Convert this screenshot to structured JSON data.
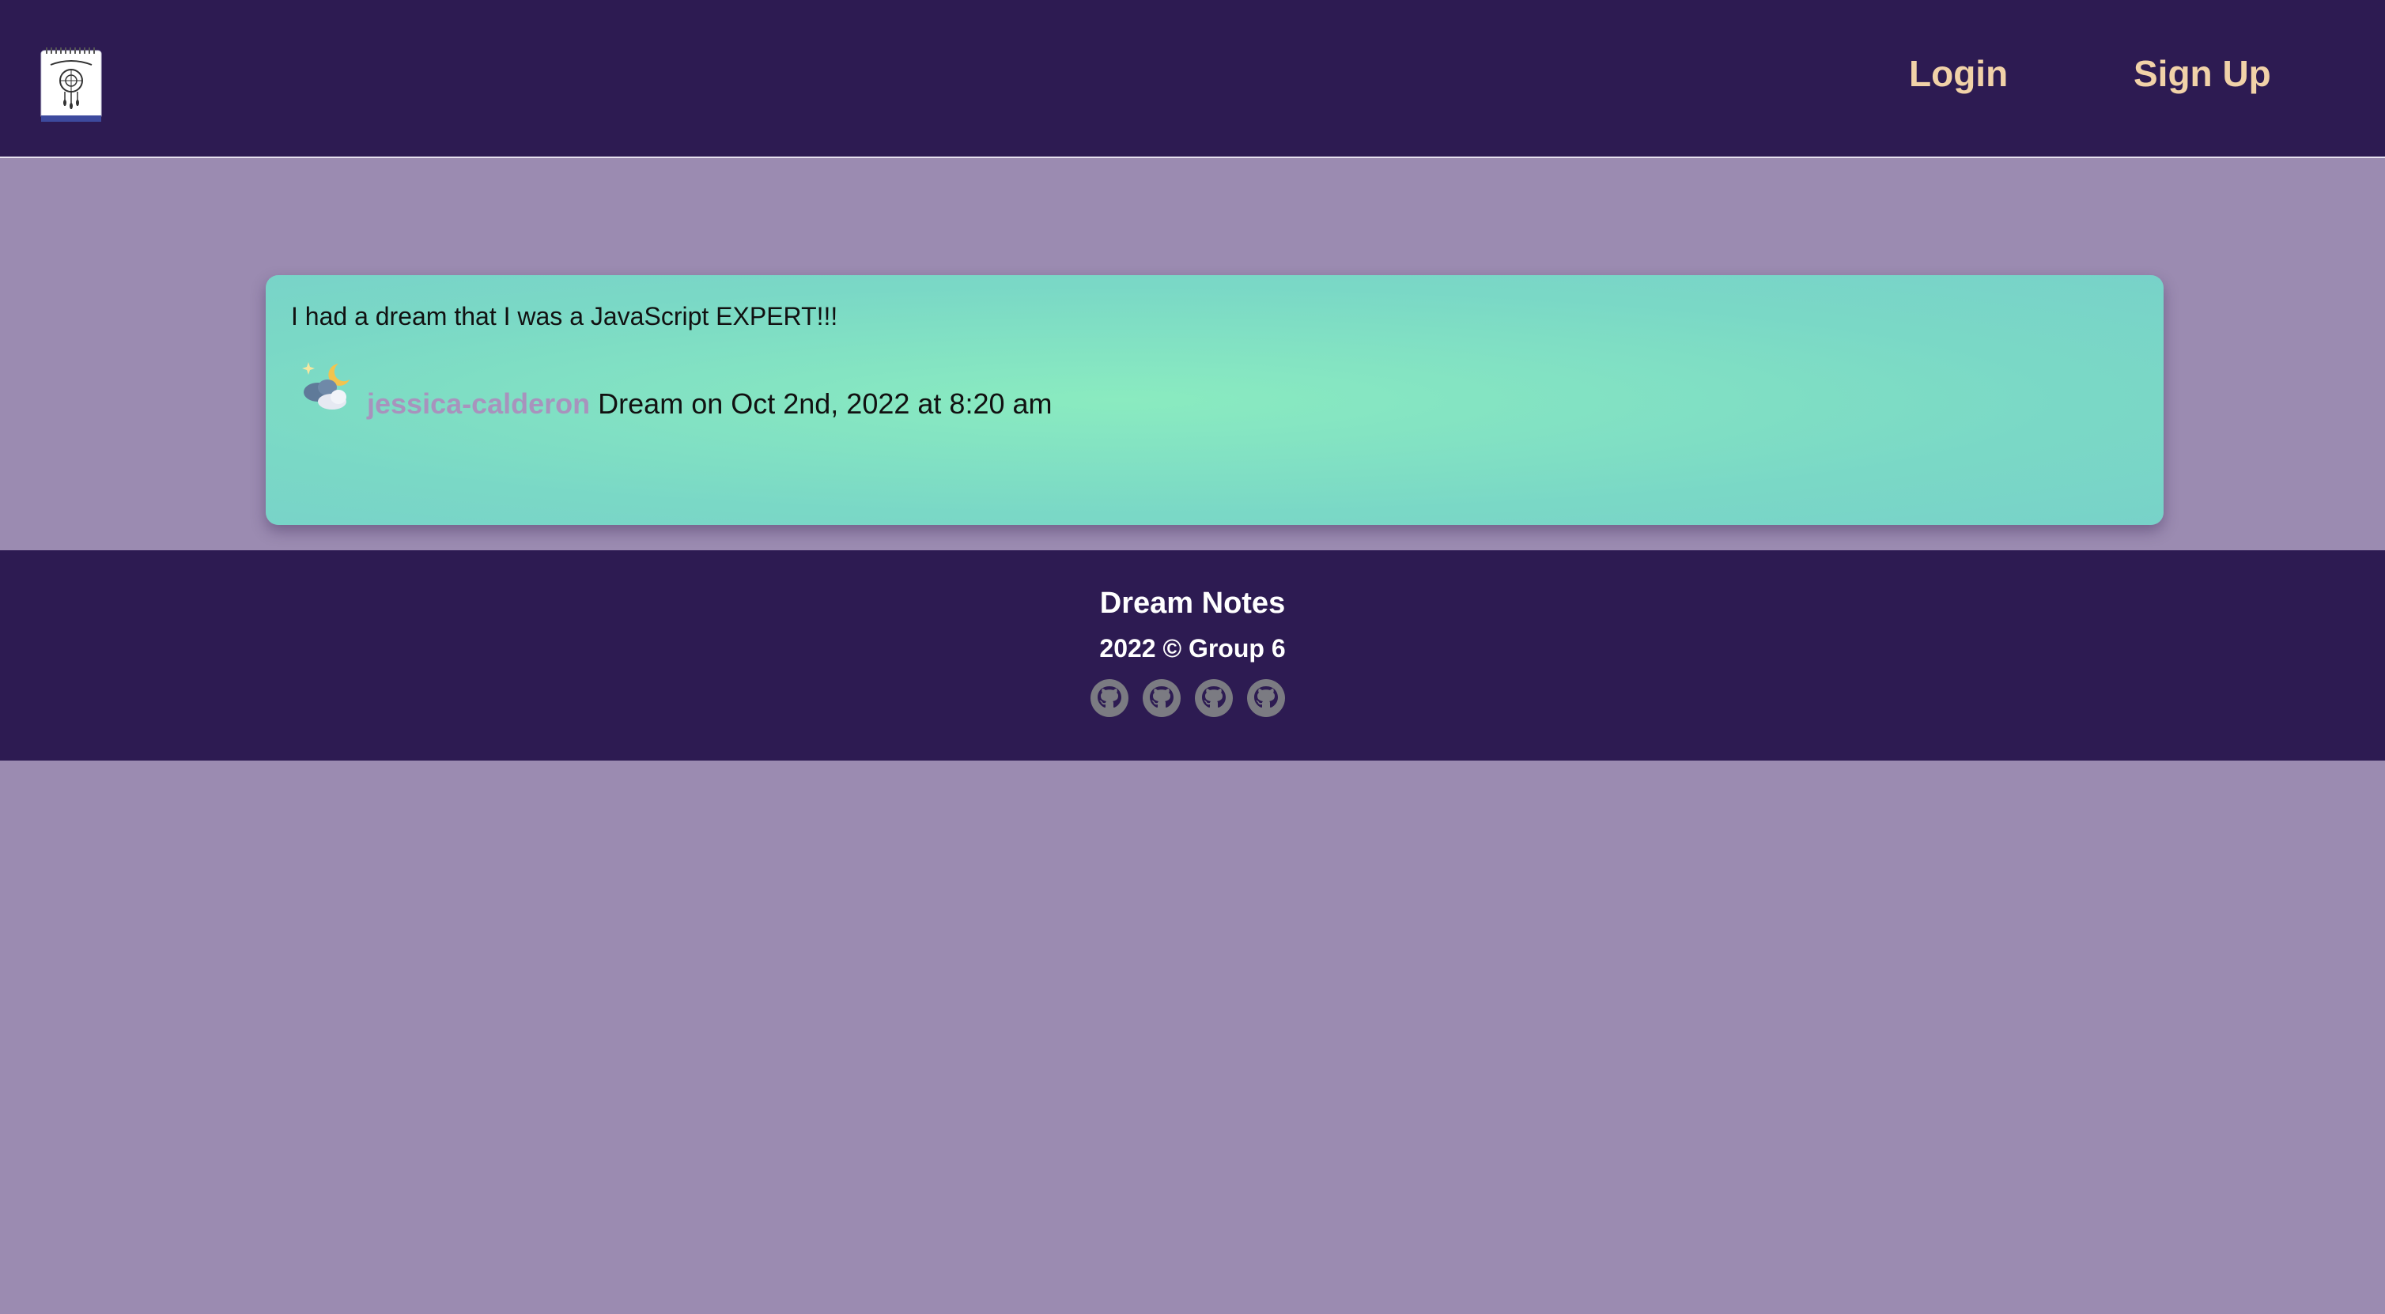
{
  "header": {
    "logo_icon": "dream-notes-logo-icon",
    "nav": {
      "login_label": "Login",
      "signup_label": "Sign Up"
    }
  },
  "dream_card": {
    "text": "I had a dream that I was a JavaScript EXPERT!!!",
    "icon": "night-cloud-moon-icon",
    "username": "jessica-calderon",
    "meta": "Dream on Oct 2nd, 2022 at 8:20 am"
  },
  "footer": {
    "title": "Dream Notes",
    "copyright": "2022 © Group 6",
    "links": [
      {
        "icon": "github-icon"
      },
      {
        "icon": "github-icon"
      },
      {
        "icon": "github-icon"
      },
      {
        "icon": "github-icon"
      }
    ]
  },
  "colors": {
    "header_bg": "#2d1b52",
    "page_bg": "#9b8bb1",
    "nav_text": "#f1d2a8",
    "card_bg": "#7ad8c6",
    "username": "#a893bd"
  }
}
